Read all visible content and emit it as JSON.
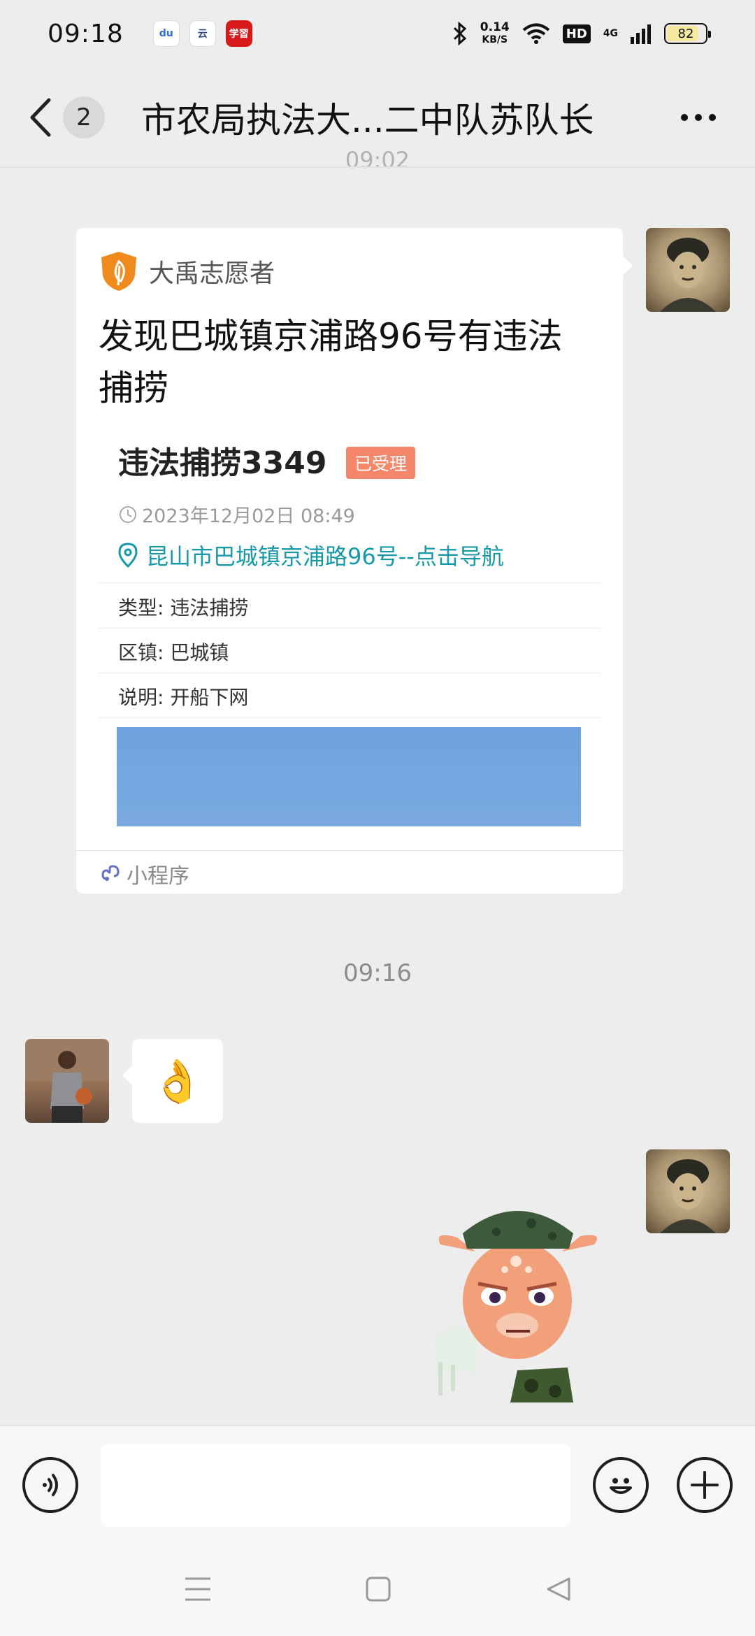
{
  "status_bar": {
    "time": "09:18",
    "apps": [
      {
        "name": "baidu-icon",
        "glyph": "du"
      },
      {
        "name": "app-icon",
        "glyph": "云"
      },
      {
        "name": "xuexi-icon",
        "glyph": "学習"
      }
    ],
    "speed_value": "0.14",
    "speed_unit": "KB/S",
    "hd": "HD",
    "network": "4G",
    "battery": "82"
  },
  "header": {
    "unread_count": "2",
    "title": "市农局执法大...二中队苏队长"
  },
  "partial_time": "09:02",
  "card": {
    "source": "大禹志愿者",
    "title": "发现巴城镇京浦路96号有违法捕捞",
    "inner_title": "违法捕捞3349",
    "status_tag": "已受理",
    "datetime": "2023年12月02日 08:49",
    "address": "昆山市巴城镇京浦路96号--点击导航",
    "rows": [
      {
        "key": "类型:",
        "value": "违法捕捞"
      },
      {
        "key": "区镇:",
        "value": "巴城镇"
      },
      {
        "key": "说明:",
        "value": "开船下网"
      }
    ],
    "footer": "小程序"
  },
  "timestamp_2": "09:16",
  "ok_message": "👌",
  "input": {
    "placeholder": "",
    "value": ""
  }
}
